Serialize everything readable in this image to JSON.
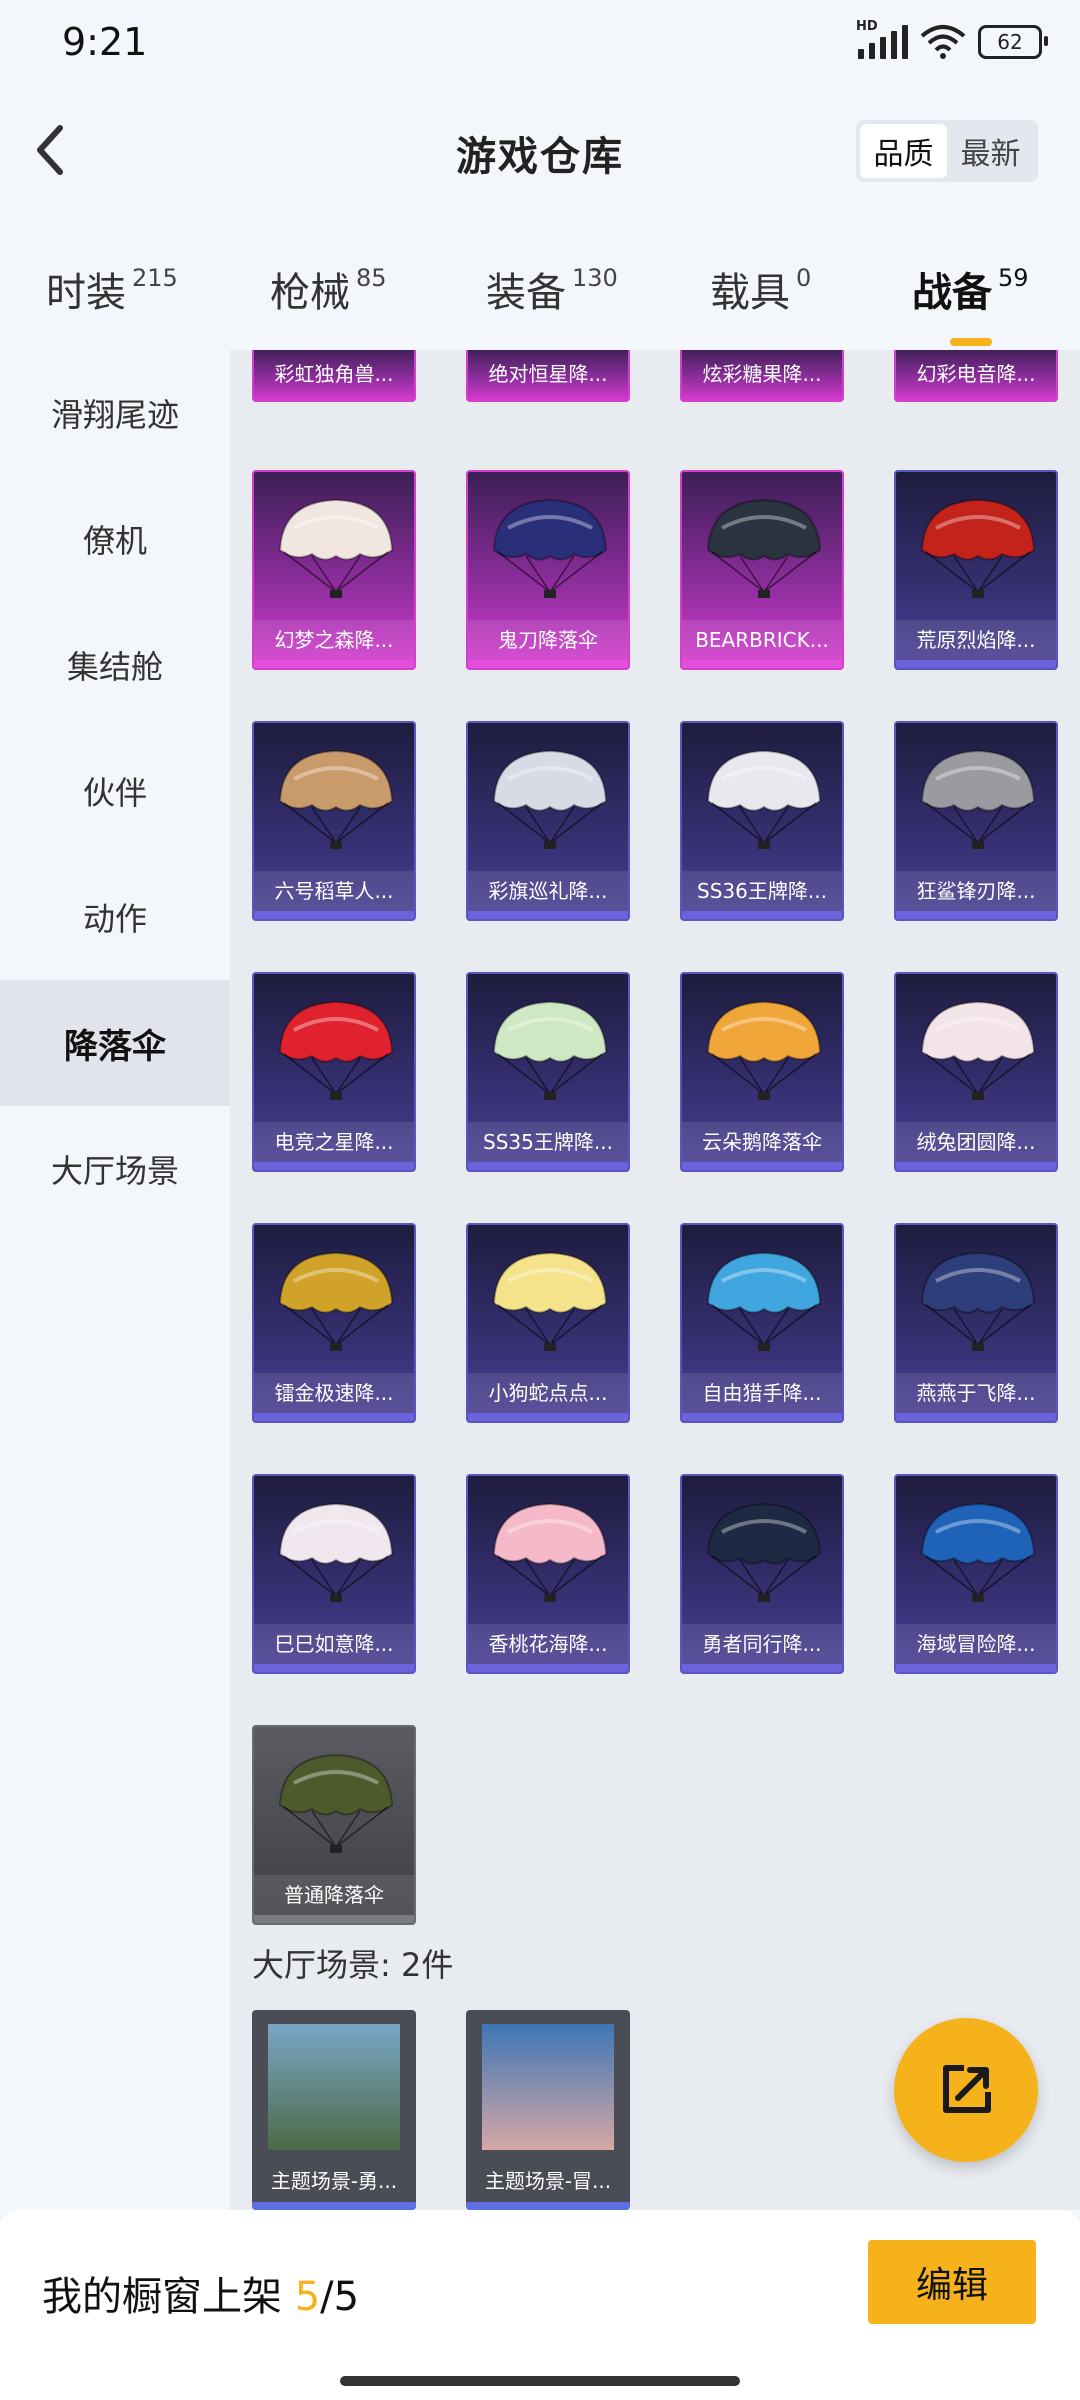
{
  "status": {
    "time": "9:21",
    "network": "HD",
    "battery": "62"
  },
  "header": {
    "title": "游戏仓库",
    "sort_options": [
      "品质",
      "最新"
    ],
    "sort_active": "品质"
  },
  "tabs": [
    {
      "label": "时装",
      "count": "215"
    },
    {
      "label": "枪械",
      "count": "85"
    },
    {
      "label": "装备",
      "count": "130"
    },
    {
      "label": "载具",
      "count": "0"
    },
    {
      "label": "战备",
      "count": "59"
    }
  ],
  "active_tab": "战备",
  "sidebar": {
    "items": [
      "滑翔尾迹",
      "僚机",
      "集结舱",
      "伙伴",
      "动作",
      "降落伞",
      "大厅场景"
    ],
    "active": "降落伞"
  },
  "top_partial_items": [
    "彩虹独角兽...",
    "绝对恒星降...",
    "炫彩糖果降...",
    "幻彩电音降..."
  ],
  "parachutes": [
    {
      "name": "幻梦之森降...",
      "rarity": "pink",
      "canopy": "#f2e6e0"
    },
    {
      "name": "鬼刀降落伞",
      "rarity": "pink",
      "canopy": "#2a2f7a"
    },
    {
      "name": "BEARBRICK...",
      "rarity": "pink",
      "canopy": "#2b3340"
    },
    {
      "name": "荒原烈焰降...",
      "rarity": "purple",
      "canopy": "#c4231c"
    },
    {
      "name": "六号稻草人...",
      "rarity": "purple",
      "canopy": "#c99b6a"
    },
    {
      "name": "彩旗巡礼降...",
      "rarity": "purple",
      "canopy": "#d7dbe6"
    },
    {
      "name": "SS36王牌降...",
      "rarity": "purple",
      "canopy": "#e8e8ee"
    },
    {
      "name": "狂鲨锋刃降...",
      "rarity": "purple",
      "canopy": "#9a9ba0"
    },
    {
      "name": "电竞之星降...",
      "rarity": "purple",
      "canopy": "#e0222e"
    },
    {
      "name": "SS35王牌降...",
      "rarity": "purple",
      "canopy": "#cfe8c4"
    },
    {
      "name": "云朵鹅降落伞",
      "rarity": "purple",
      "canopy": "#f1a63a"
    },
    {
      "name": "绒兔团圆降...",
      "rarity": "purple",
      "canopy": "#f3e4ea"
    },
    {
      "name": "镭金极速降...",
      "rarity": "purple",
      "canopy": "#d0a22a"
    },
    {
      "name": "小狗蛇点点...",
      "rarity": "purple",
      "canopy": "#f4e38a"
    },
    {
      "name": "自由猎手降...",
      "rarity": "purple",
      "canopy": "#3fa6e0"
    },
    {
      "name": "燕燕于飞降...",
      "rarity": "purple",
      "canopy": "#2d3e7a"
    },
    {
      "name": "巳巳如意降...",
      "rarity": "purple",
      "canopy": "#f0e8ee"
    },
    {
      "name": "香桃花海降...",
      "rarity": "purple",
      "canopy": "#f6b9c9"
    },
    {
      "name": "勇者同行降...",
      "rarity": "purple",
      "canopy": "#1e2a44"
    },
    {
      "name": "海域冒险降...",
      "rarity": "purple",
      "canopy": "#1e63b8"
    },
    {
      "name": "普通降落伞",
      "rarity": "gray",
      "canopy": "#4d5a2c"
    }
  ],
  "scene_section": {
    "label": "大厅场景: 2件",
    "items": [
      {
        "name": "主题场景-勇...",
        "palette": [
          "#7aa6c8",
          "#4c6a46"
        ]
      },
      {
        "name": "主题场景-冒...",
        "palette": [
          "#3d76b5",
          "#d6a7a6"
        ]
      }
    ]
  },
  "bottom": {
    "shelf_label": "我的橱窗上架",
    "shelf_current": "5",
    "shelf_sep": "/",
    "shelf_total": "5",
    "edit_label": "编辑"
  },
  "colors": {
    "accent": "#f5b21b",
    "pink_rarity": "#d43ecc",
    "purple_rarity": "#5a55c0"
  },
  "icons": {
    "back": "chevron-left-icon",
    "share": "share-external-icon"
  }
}
